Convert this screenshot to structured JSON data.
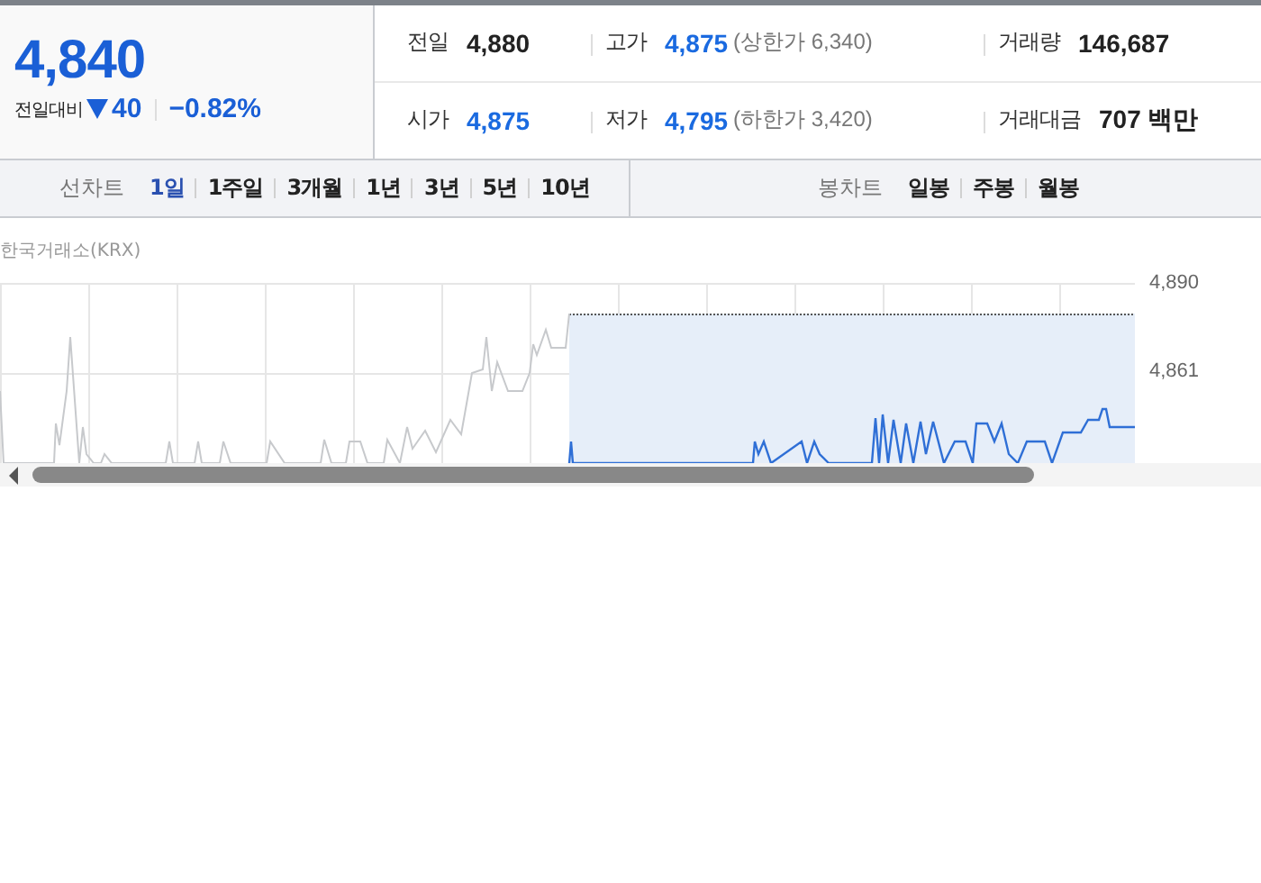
{
  "quote": {
    "price": "4,840",
    "change_label": "전일대비",
    "falling": true,
    "change": "40",
    "change_rate": "−0.82%"
  },
  "stats": [
    {
      "label": "전일",
      "value": "4,880",
      "kind": "plain"
    },
    {
      "label": "고가",
      "value": "4,875",
      "kind": "price",
      "note": "(상한가 6,340)"
    },
    {
      "label": "거래량",
      "value": "146,687",
      "kind": "plain"
    },
    {
      "label": "시가",
      "value": "4,875",
      "kind": "price"
    },
    {
      "label": "저가",
      "value": "4,795",
      "kind": "price",
      "note": "(하한가 3,420)"
    },
    {
      "label": "거래대금",
      "value": "707 백만",
      "kind": "plain"
    }
  ],
  "line_chart_tabs": {
    "label": "선차트",
    "periods": [
      {
        "label": "1일",
        "selected": true
      },
      {
        "label": "1주일",
        "selected": false
      },
      {
        "label": "3개월",
        "selected": false
      },
      {
        "label": "1년",
        "selected": false
      },
      {
        "label": "3년",
        "selected": false
      },
      {
        "label": "5년",
        "selected": false
      },
      {
        "label": "10년",
        "selected": false
      }
    ]
  },
  "candle_chart_tabs": {
    "label": "봉차트",
    "periods": [
      {
        "label": "일봉",
        "selected": false
      },
      {
        "label": "주봉",
        "selected": false
      },
      {
        "label": "월봉",
        "selected": false
      }
    ]
  },
  "chart": {
    "source": "한국거래소(KRX)",
    "y_labels": [
      "4,890",
      "4,861"
    ]
  }
}
